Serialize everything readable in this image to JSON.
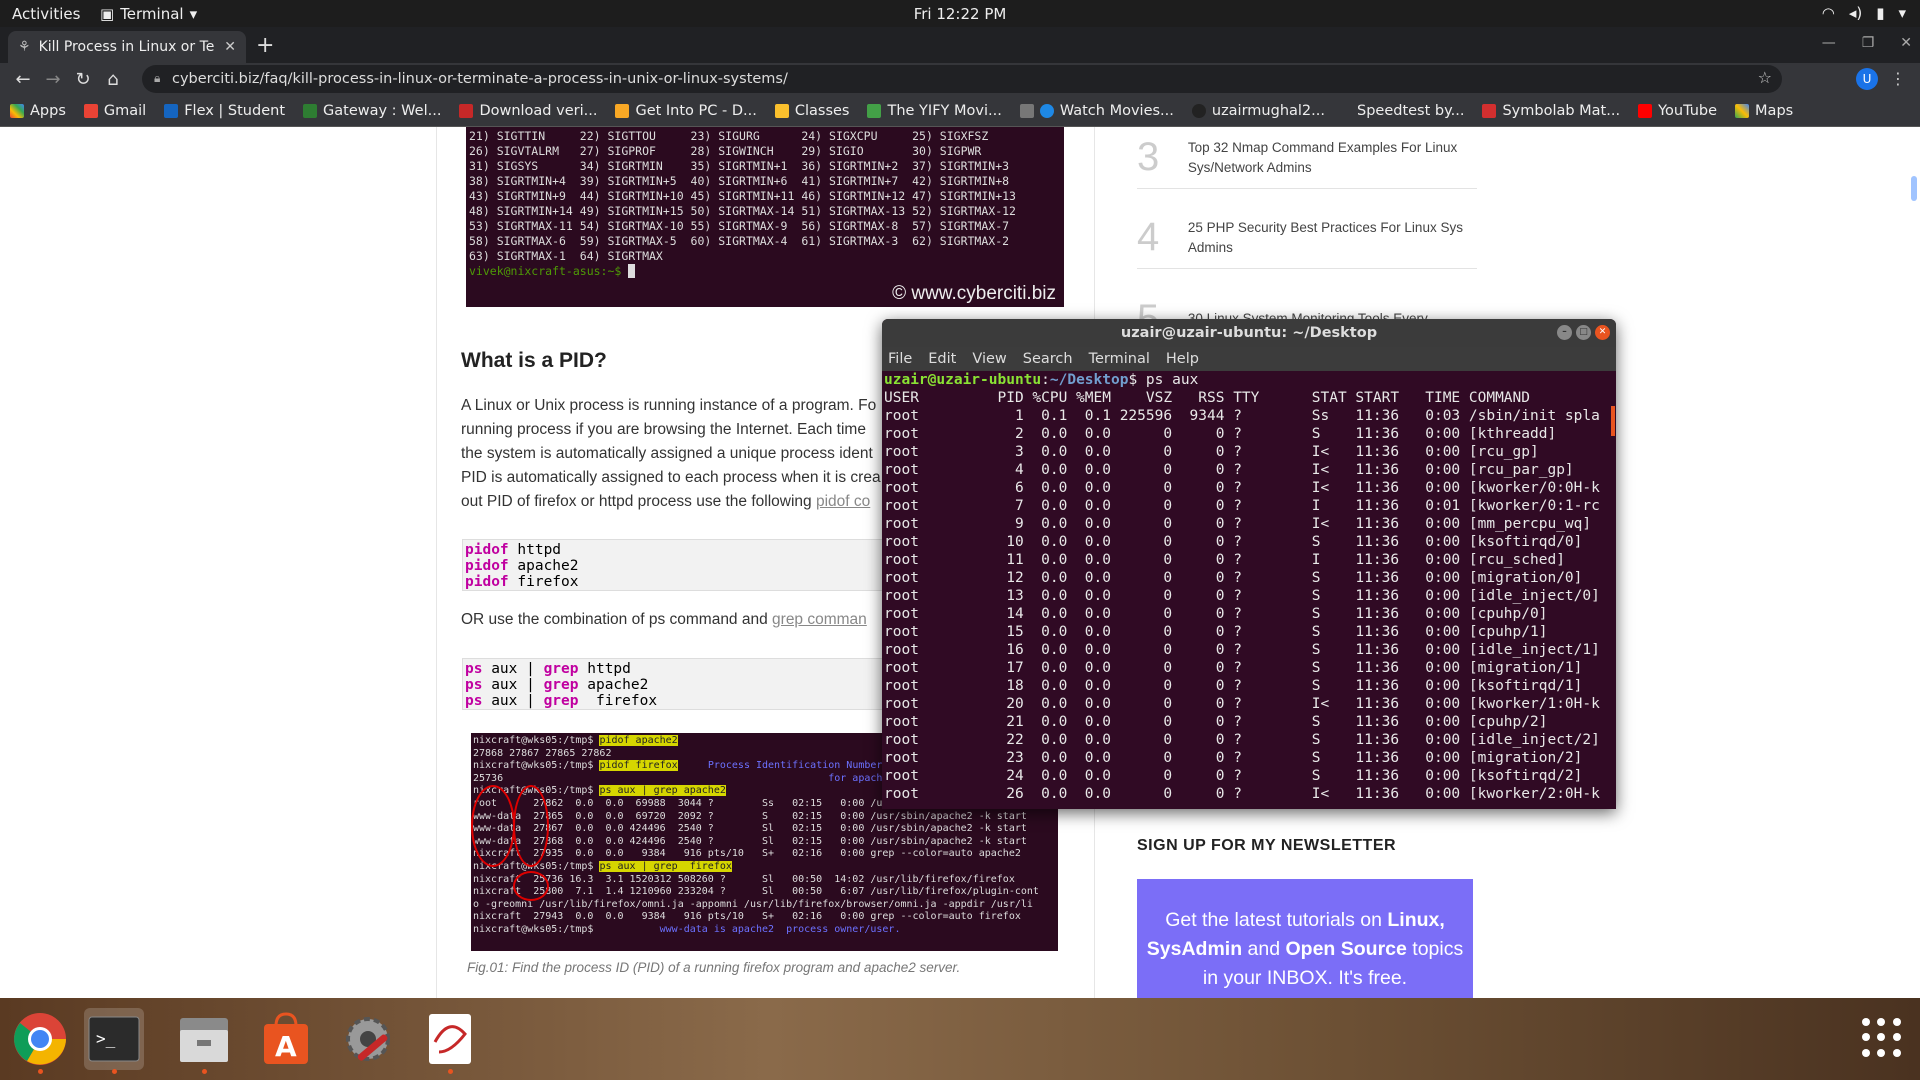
{
  "topbar": {
    "activities": "Activities",
    "app": "Terminal",
    "clock": "Fri 12:22 PM"
  },
  "browser": {
    "tab_title": "Kill Process in Linux or Te",
    "url": "cyberciti.biz/faq/kill-process-in-linux-or-terminate-a-process-in-unix-or-linux-systems/",
    "avatar_letter": "U",
    "bookmarks": [
      "Apps",
      "Gmail",
      "Flex | Student",
      "Gateway : Wel...",
      "Download veri...",
      "Get Into PC - D...",
      "Classes",
      "The YIFY Movi...",
      "Watch Movies...",
      "uzairmughal2...",
      "Speedtest by...",
      "Symbolab Mat...",
      "YouTube",
      "Maps"
    ]
  },
  "article": {
    "signals_lines": [
      "21) SIGTTIN     22) SIGTTOU     23) SIGURG      24) SIGXCPU     25) SIGXFSZ",
      "26) SIGVTALRM   27) SIGPROF     28) SIGWINCH    29) SIGIO       30) SIGPWR",
      "31) SIGSYS      34) SIGRTMIN    35) SIGRTMIN+1  36) SIGRTMIN+2  37) SIGRTMIN+3",
      "38) SIGRTMIN+4  39) SIGRTMIN+5  40) SIGRTMIN+6  41) SIGRTMIN+7  42) SIGRTMIN+8",
      "43) SIGRTMIN+9  44) SIGRTMIN+10 45) SIGRTMIN+11 46) SIGRTMIN+12 47) SIGRTMIN+13",
      "48) SIGRTMIN+14 49) SIGRTMIN+15 50) SIGRTMAX-14 51) SIGRTMAX-13 52) SIGRTMAX-12",
      "53) SIGRTMAX-11 54) SIGRTMAX-10 55) SIGRTMAX-9  56) SIGRTMAX-8  57) SIGRTMAX-7",
      "58) SIGRTMAX-6  59) SIGRTMAX-5  60) SIGRTMAX-4  61) SIGRTMAX-3  62) SIGRTMAX-2",
      "63) SIGRTMAX-1  64) SIGRTMAX"
    ],
    "signals_prompt": "vivek@nixcraft-asus:~$ ",
    "watermark": "© www.cyberciti.biz",
    "heading": "What is a PID?",
    "para_lines": [
      "A Linux or Unix process is running instance of a program. Fo",
      "running process if you are browsing the Internet. Each time",
      "the system is automatically assigned a unique process ident",
      "PID is automatically assigned to each process when it is crea",
      "out PID of firefox or httpd process use the following "
    ],
    "para_link": "pidof co",
    "code1": [
      {
        "k": "pidof",
        "a": " httpd"
      },
      {
        "k": "pidof",
        "a": " apache2"
      },
      {
        "k": "pidof",
        "a": " firefox"
      }
    ],
    "or_text": "OR use the combination of ps command and ",
    "or_link": "grep comman",
    "code2": [
      {
        "a": " aux | ",
        "b": " httpd"
      },
      {
        "a": " aux | ",
        "b": " apache2"
      },
      {
        "a": " aux | ",
        "b": "  firefox"
      }
    ],
    "code2_ps": "ps",
    "code2_grep": "grep",
    "caption": "Fig.01: Find the process ID (PID) of a running firefox program and apache2 server."
  },
  "sidebar": {
    "items": [
      {
        "num": "3",
        "text": "Top 32 Nmap Command Examples For Linux Sys/Network Admins"
      },
      {
        "num": "4",
        "text": "25 PHP Security Best Practices For Linux Sys Admins"
      },
      {
        "num": "5",
        "text": "30 Linux System Monitoring Tools Every"
      }
    ],
    "newsletter_title": "SIGN UP FOR MY NEWSLETTER",
    "newsletter_parts": [
      "Get the latest tutorials on ",
      "Linux,",
      "SysAdmin",
      " and ",
      "Open Source",
      " topics",
      "in your INBOX. It's free."
    ]
  },
  "terminal": {
    "title": "uzair@uzair-ubuntu: ~/Desktop",
    "menu": [
      "File",
      "Edit",
      "View",
      "Search",
      "Terminal",
      "Help"
    ],
    "prompt_user": "uzair@uzair-ubuntu",
    "prompt_path": "~/Desktop",
    "command": "ps aux",
    "header": "USER         PID %CPU %MEM    VSZ   RSS TTY      STAT START   TIME COMMAND",
    "rows": [
      "root           1  0.1  0.1 225596  9344 ?        Ss   11:36   0:03 /sbin/init spla",
      "root           2  0.0  0.0      0     0 ?        S    11:36   0:00 [kthreadd]",
      "root           3  0.0  0.0      0     0 ?        I<   11:36   0:00 [rcu_gp]",
      "root           4  0.0  0.0      0     0 ?        I<   11:36   0:00 [rcu_par_gp]",
      "root           6  0.0  0.0      0     0 ?        I<   11:36   0:00 [kworker/0:0H-k",
      "root           7  0.0  0.0      0     0 ?        I    11:36   0:01 [kworker/0:1-rc",
      "root           9  0.0  0.0      0     0 ?        I<   11:36   0:00 [mm_percpu_wq]",
      "root          10  0.0  0.0      0     0 ?        S    11:36   0:00 [ksoftirqd/0]",
      "root          11  0.0  0.0      0     0 ?        I    11:36   0:00 [rcu_sched]",
      "root          12  0.0  0.0      0     0 ?        S    11:36   0:00 [migration/0]",
      "root          13  0.0  0.0      0     0 ?        S    11:36   0:00 [idle_inject/0]",
      "root          14  0.0  0.0      0     0 ?        S    11:36   0:00 [cpuhp/0]",
      "root          15  0.0  0.0      0     0 ?        S    11:36   0:00 [cpuhp/1]",
      "root          16  0.0  0.0      0     0 ?        S    11:36   0:00 [idle_inject/1]",
      "root          17  0.0  0.0      0     0 ?        S    11:36   0:00 [migration/1]",
      "root          18  0.0  0.0      0     0 ?        S    11:36   0:00 [ksoftirqd/1]",
      "root          20  0.0  0.0      0     0 ?        I<   11:36   0:00 [kworker/1:0H-k",
      "root          21  0.0  0.0      0     0 ?        S    11:36   0:00 [cpuhp/2]",
      "root          22  0.0  0.0      0     0 ?        S    11:36   0:00 [idle_inject/2]",
      "root          23  0.0  0.0      0     0 ?        S    11:36   0:00 [migration/2]",
      "root          24  0.0  0.0      0     0 ?        S    11:36   0:00 [ksoftirqd/2]",
      "root          26  0.0  0.0      0     0 ?        I<   11:36   0:00 [kworker/2:0H-k"
    ]
  },
  "figure": {
    "lines": [
      {
        "t": "nixcraft@wks05:/tmp$ ",
        "h": "pidof apache2"
      },
      {
        "t": "27868 27867 27865 27862"
      },
      {
        "t": "nixcraft@wks05:/tmp$ ",
        "h": "pidof firefox",
        "n": "     Process Identification Number (PID)"
      },
      {
        "t": "25736",
        "n": "                                                      for apache2 server"
      },
      {
        "t": "nixcraft@wks05:/tmp$ ",
        "h": "ps aux | grep apache2"
      },
      {
        "t": "root      27862  0.0  0.0  69988  3044 ?        Ss   02:15   0:00 /usr/sbin/apache2 -k start"
      },
      {
        "t": "www-data  27865  0.0  0.0  69720  2092 ?        S    02:15   0:00 /usr/sbin/apache2 -k start"
      },
      {
        "t": "www-data  27867  0.0  0.0 424496  2540 ?        Sl   02:15   0:00 /usr/sbin/apache2 -k start"
      },
      {
        "t": "www-data  27868  0.0  0.0 424496  2540 ?        Sl   02:15   0:00 /usr/sbin/apache2 -k start"
      },
      {
        "t": "nixcraft  27935  0.0  0.0   9384   916 pts/10   S+   02:16   0:00 grep --color=auto apache2"
      },
      {
        "t": "nixcraft@wks05:/tmp$ ",
        "h": "ps aux | grep  firefox"
      },
      {
        "t": "nixcraft  25736 16.3  3.1 1520312 508260 ?      Sl   00:50  14:02 /usr/lib/firefox/firefox"
      },
      {
        "t": "nixcraft  25800  7.1  1.4 1210960 233204 ?      Sl   00:50   6:07 /usr/lib/firefox/plugin-cont"
      },
      {
        "t": "o -greomni /usr/lib/firefox/omni.ja -appomni /usr/lib/firefox/browser/omni.ja -appdir /usr/li"
      },
      {
        "t": "nixcraft  27943  0.0  0.0   9384   916 pts/10   S+   02:16   0:00 grep --color=auto firefox"
      },
      {
        "t": "nixcraft@wks05:/tmp$ ",
        "n": "          www-data is apache2  process owner/user."
      }
    ]
  },
  "colors": {
    "accent": "#e95420",
    "terminal_bg": "#300a24",
    "newsletter_bg": "#7b6ef7"
  }
}
